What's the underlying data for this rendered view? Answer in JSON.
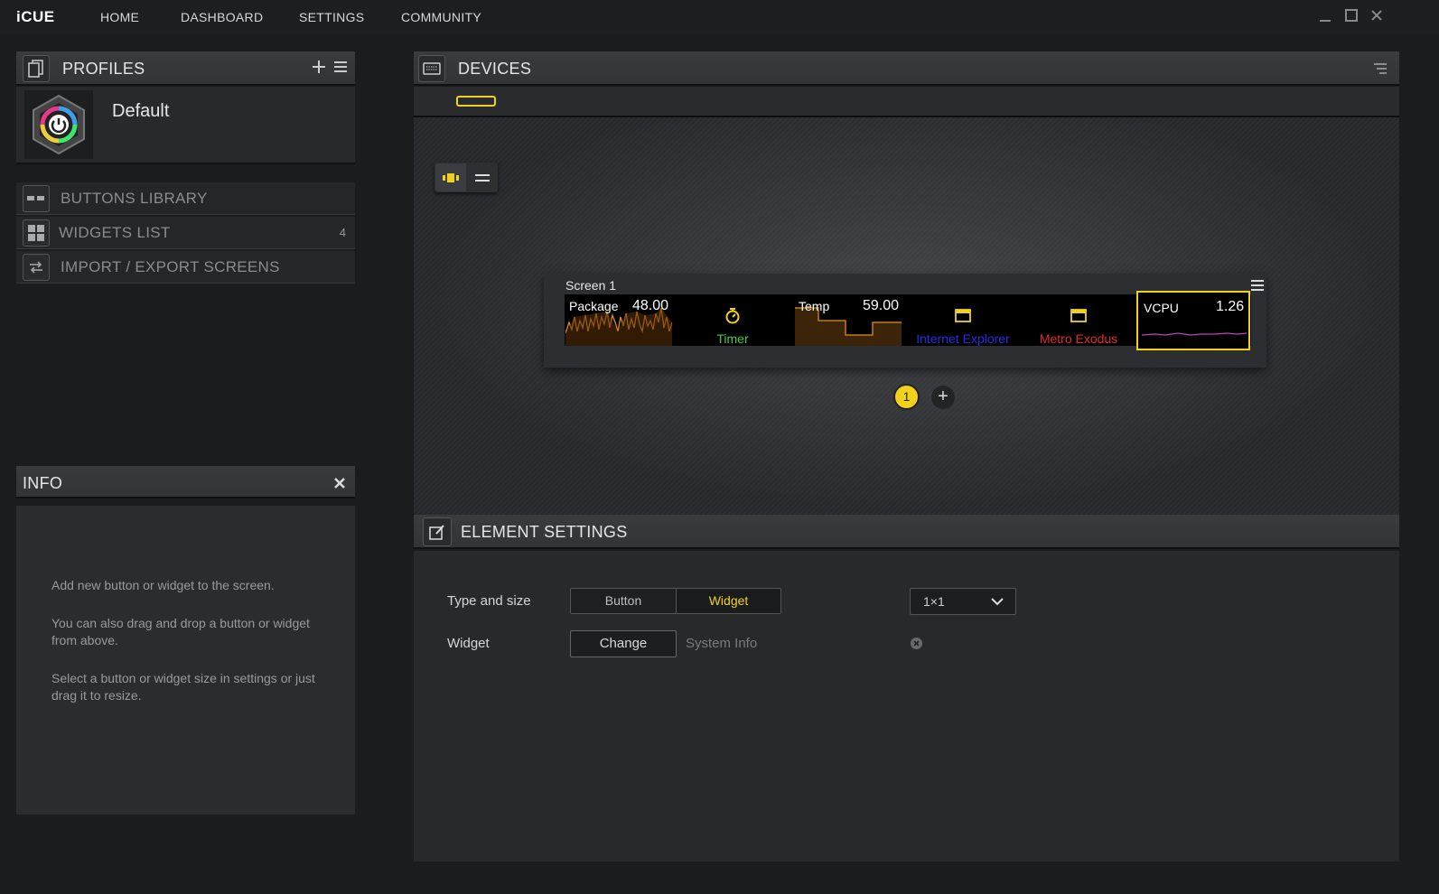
{
  "app": {
    "logo": "iCUE",
    "nav": [
      "HOME",
      "DASHBOARD",
      "SETTINGS",
      "COMMUNITY"
    ],
    "window_controls": [
      "minimize-icon",
      "maximize-icon",
      "close-icon"
    ]
  },
  "profiles": {
    "title": "PROFILES",
    "active_profile": "Default",
    "library": [
      {
        "label": "BUTTONS LIBRARY",
        "icon": "buttons-library-icon",
        "count": ""
      },
      {
        "label": "WIDGETS LIST",
        "icon": "widgets-grid-icon",
        "count": "4"
      },
      {
        "label": "IMPORT / EXPORT SCREENS",
        "icon": "import-export-icon",
        "count": ""
      }
    ]
  },
  "info": {
    "title": "INFO",
    "paragraphs": [
      "Add new button or widget to the screen.",
      "You can also drag and drop a button or widget from above.",
      "Select a button or widget size in settings or just drag it to resize."
    ]
  },
  "devices": {
    "title": "DEVICES",
    "screen": {
      "name": "Screen 1",
      "widgets": [
        {
          "label": "Package",
          "value": "48.00"
        },
        {
          "label": "Timer",
          "color": "#3fd23f"
        },
        {
          "label": "Temp",
          "value": "59.00"
        },
        {
          "label": "Internet Explorer",
          "color": "#2a2ae6"
        },
        {
          "label": "Metro Exodus",
          "color": "#e22a2a"
        },
        {
          "label": "VCPU",
          "value": "1.26"
        }
      ]
    },
    "page_number": "1"
  },
  "element_settings": {
    "title": "ELEMENT SETTINGS",
    "type_label": "Type and size",
    "type_options": [
      "Button",
      "Widget"
    ],
    "selected_type": "Widget",
    "size_value": "1×1",
    "widget_label": "Widget",
    "change_label": "Change",
    "widget_name": "System Info"
  },
  "colors": {
    "accent": "#f2d11c",
    "background": "#1b1c1e"
  }
}
